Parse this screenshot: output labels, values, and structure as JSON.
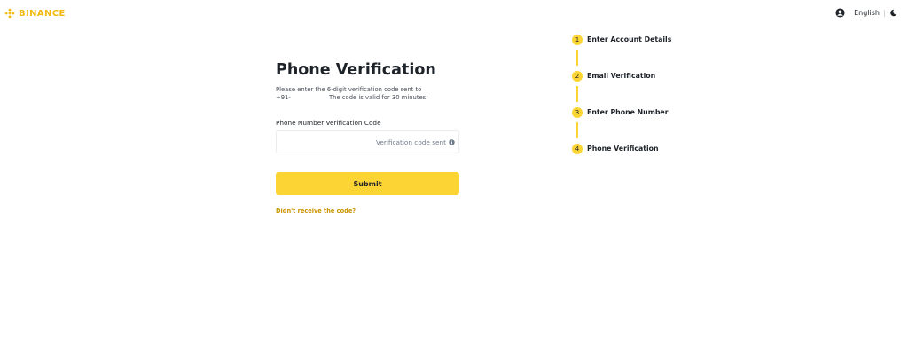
{
  "header": {
    "brand": "BINANCE",
    "language": "English"
  },
  "form": {
    "title": "Phone Verification",
    "description_line1": "Please enter the 6-digit verification code sent to",
    "phone_prefix": "+91-",
    "validity_text": "The code is valid for 30 minutes.",
    "field_label": "Phone Number Verification Code",
    "input_value": "",
    "input_status": "Verification code sent",
    "submit_label": "Submit",
    "resend_link": "Didn't receive the code?"
  },
  "stepper": {
    "steps": [
      {
        "number": "1",
        "label": "Enter Account Details"
      },
      {
        "number": "2",
        "label": "Email Verification"
      },
      {
        "number": "3",
        "label": "Enter Phone Number"
      },
      {
        "number": "4",
        "label": "Phone Verification"
      }
    ]
  },
  "colors": {
    "brand": "#f0b90b",
    "accent": "#fcd535",
    "link": "#c99400",
    "text": "#1e2329"
  }
}
